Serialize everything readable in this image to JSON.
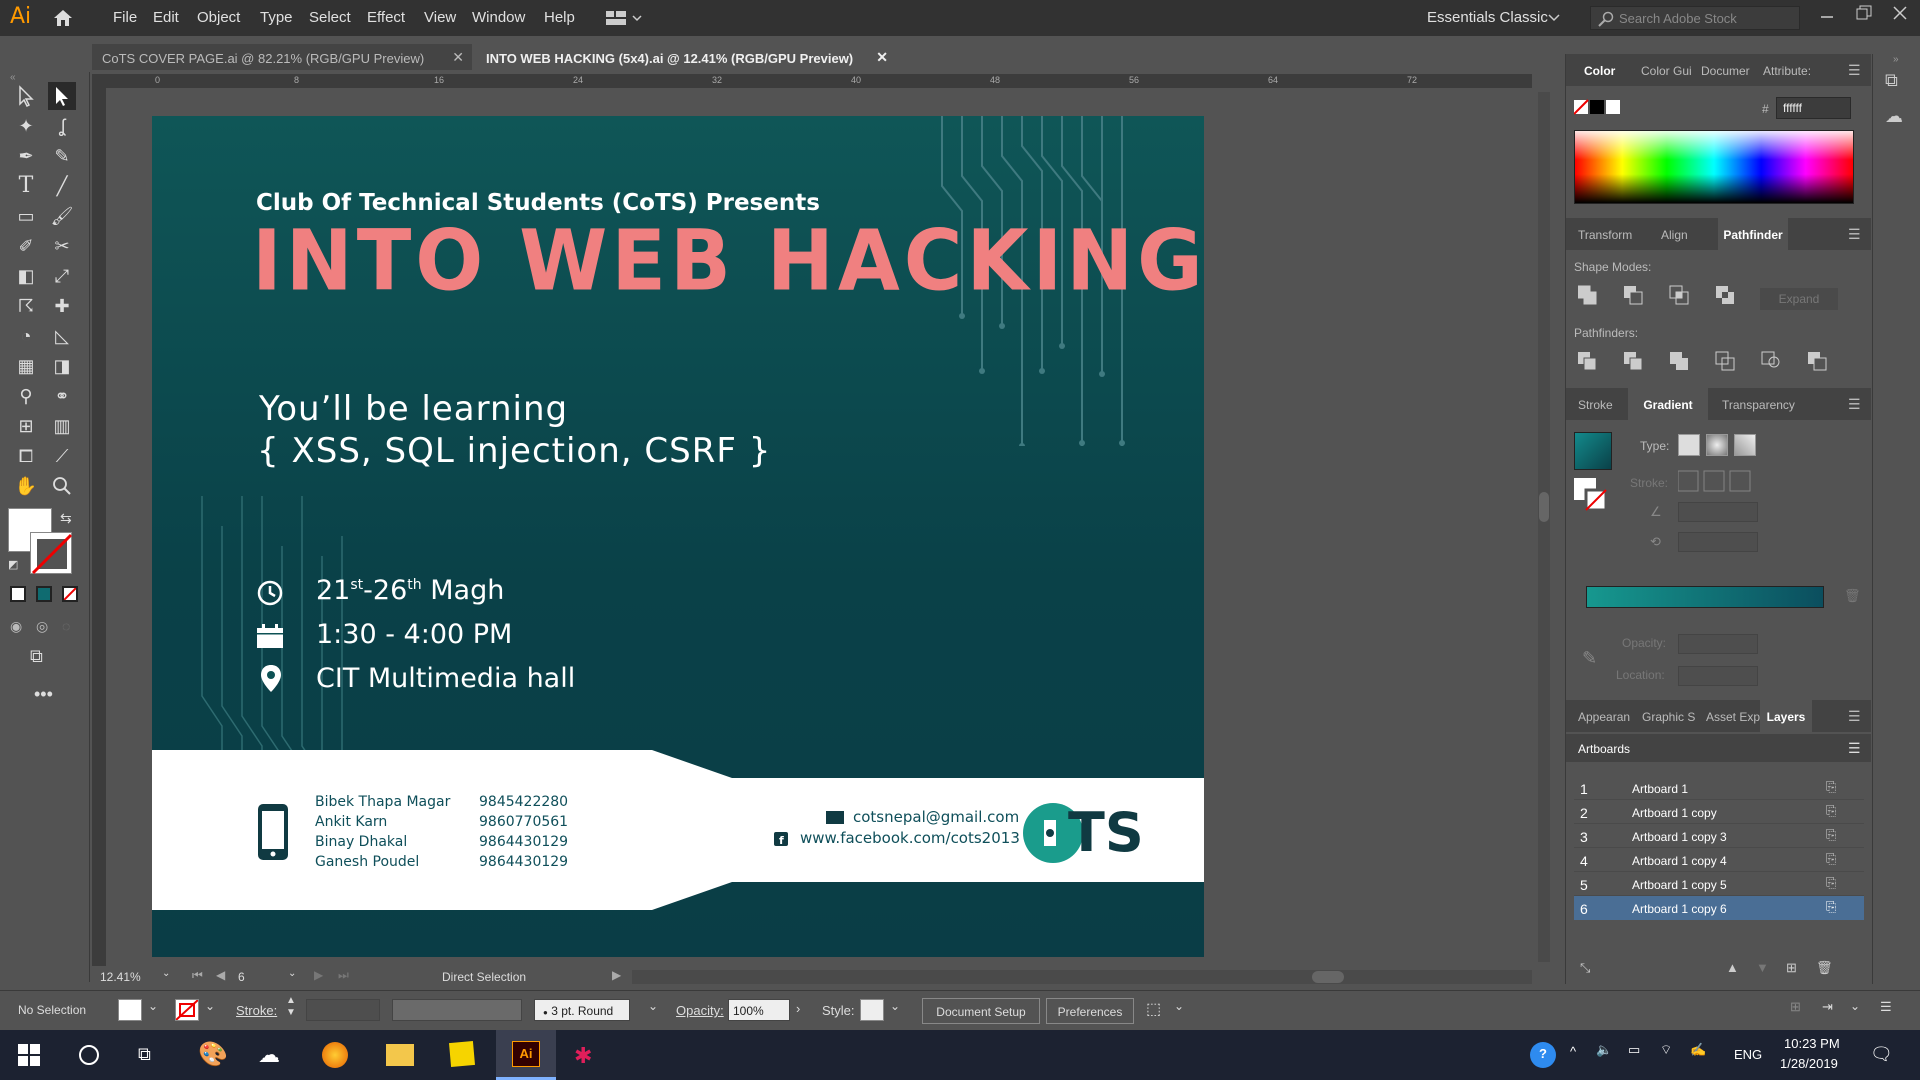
{
  "app": {
    "logo": "Ai",
    "menu": [
      "File",
      "Edit",
      "Object",
      "Type",
      "Select",
      "Effect",
      "View",
      "Window",
      "Help"
    ],
    "workspace": "Essentials Classic",
    "search_placeholder": "Search Adobe Stock"
  },
  "tabs": [
    {
      "label": "CoTS COVER PAGE.ai @ 82.21% (RGB/GPU Preview)",
      "active": false
    },
    {
      "label": "INTO WEB HACKING (5x4).ai @ 12.41% (RGB/GPU Preview)",
      "active": true
    }
  ],
  "ruler_top": [
    "0",
    "8",
    "16",
    "24",
    "32",
    "40",
    "48",
    "56",
    "64",
    "72"
  ],
  "ruler_left": [
    "0",
    "8",
    "1 6",
    "2 4",
    "3 2",
    "4 0",
    "4 8"
  ],
  "artboard": {
    "presenter": "Club Of Technical Students (CoTS) Presents",
    "title": "INTO WEB HACKING",
    "learning_line1": "You’ll be learning",
    "learning_line2": "{ XSS, SQL injection, CSRF }",
    "date_main": "21",
    "date_sup1": "st",
    "date_mid": "-26",
    "date_sup2": "th",
    "date_end": " Magh",
    "time": "1:30 - 4:00 PM",
    "venue": "CIT Multimedia hall",
    "contacts": [
      {
        "name": "Bibek Thapa Magar",
        "phone": "9845422280"
      },
      {
        "name": "Ankit Karn",
        "phone": "9860770561"
      },
      {
        "name": "Binay Dhakal",
        "phone": "9864430129"
      },
      {
        "name": "Ganesh Poudel",
        "phone": "9864430129"
      }
    ],
    "email": "cotsnepal@gmail.com",
    "facebook": "www.facebook.com/cots2013",
    "logo_text": "TS",
    "colors": {
      "title": "#f08080",
      "teal": "#0d5154",
      "logo": "#1a9c8c"
    }
  },
  "panels": {
    "color_tabs": [
      "Color",
      "Color Gui",
      "Documer",
      "Attribute:"
    ],
    "hex_label": "#",
    "hex_value": "ffffff",
    "mid_tabs": [
      "Transform",
      "Align",
      "Pathfinder"
    ],
    "shape_modes": "Shape Modes:",
    "expand": "Expand",
    "pathfinders": "Pathfinders:",
    "gradient_tabs": [
      "Stroke",
      "Gradient",
      "Transparency"
    ],
    "type_label": "Type:",
    "stroke_label": "Stroke:",
    "opacity_label": "Opacity:",
    "location_label": "Location:",
    "bottom_tabs": [
      "Appearan",
      "Graphic S",
      "Asset Exp",
      "Layers"
    ],
    "artboards_title": "Artboards",
    "artboards": [
      {
        "num": "1",
        "name": "Artboard 1"
      },
      {
        "num": "2",
        "name": "Artboard 1 copy"
      },
      {
        "num": "3",
        "name": "Artboard 1 copy 3"
      },
      {
        "num": "4",
        "name": "Artboard 1 copy 4"
      },
      {
        "num": "5",
        "name": "Artboard 1 copy 5"
      },
      {
        "num": "6",
        "name": "Artboard 1 copy 6"
      }
    ]
  },
  "status": {
    "zoom": "12.41%",
    "artboard_num": "6",
    "tool": "Direct Selection"
  },
  "control": {
    "selection": "No Selection",
    "stroke_label": "Stroke:",
    "brush": "3 pt. Round",
    "opacity_label": "Opacity:",
    "opacity": "100%",
    "style_label": "Style:",
    "doc_setup": "Document Setup",
    "preferences": "Preferences"
  },
  "taskbar": {
    "lang": "ENG",
    "time": "10:23 PM",
    "date": "1/28/2019"
  }
}
